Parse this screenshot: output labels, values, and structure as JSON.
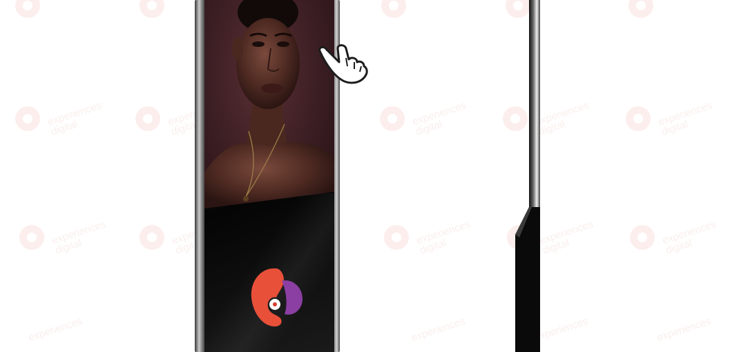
{
  "watermark": {
    "line1": "experiences",
    "line2": "digital"
  },
  "brand": {
    "logo": "ed-logo-icon",
    "colors": {
      "orange": "#e8503a",
      "red": "#d93a32",
      "purple": "#8b3fa3"
    }
  },
  "scene": {
    "pointer": "pointing-hand-icon"
  }
}
